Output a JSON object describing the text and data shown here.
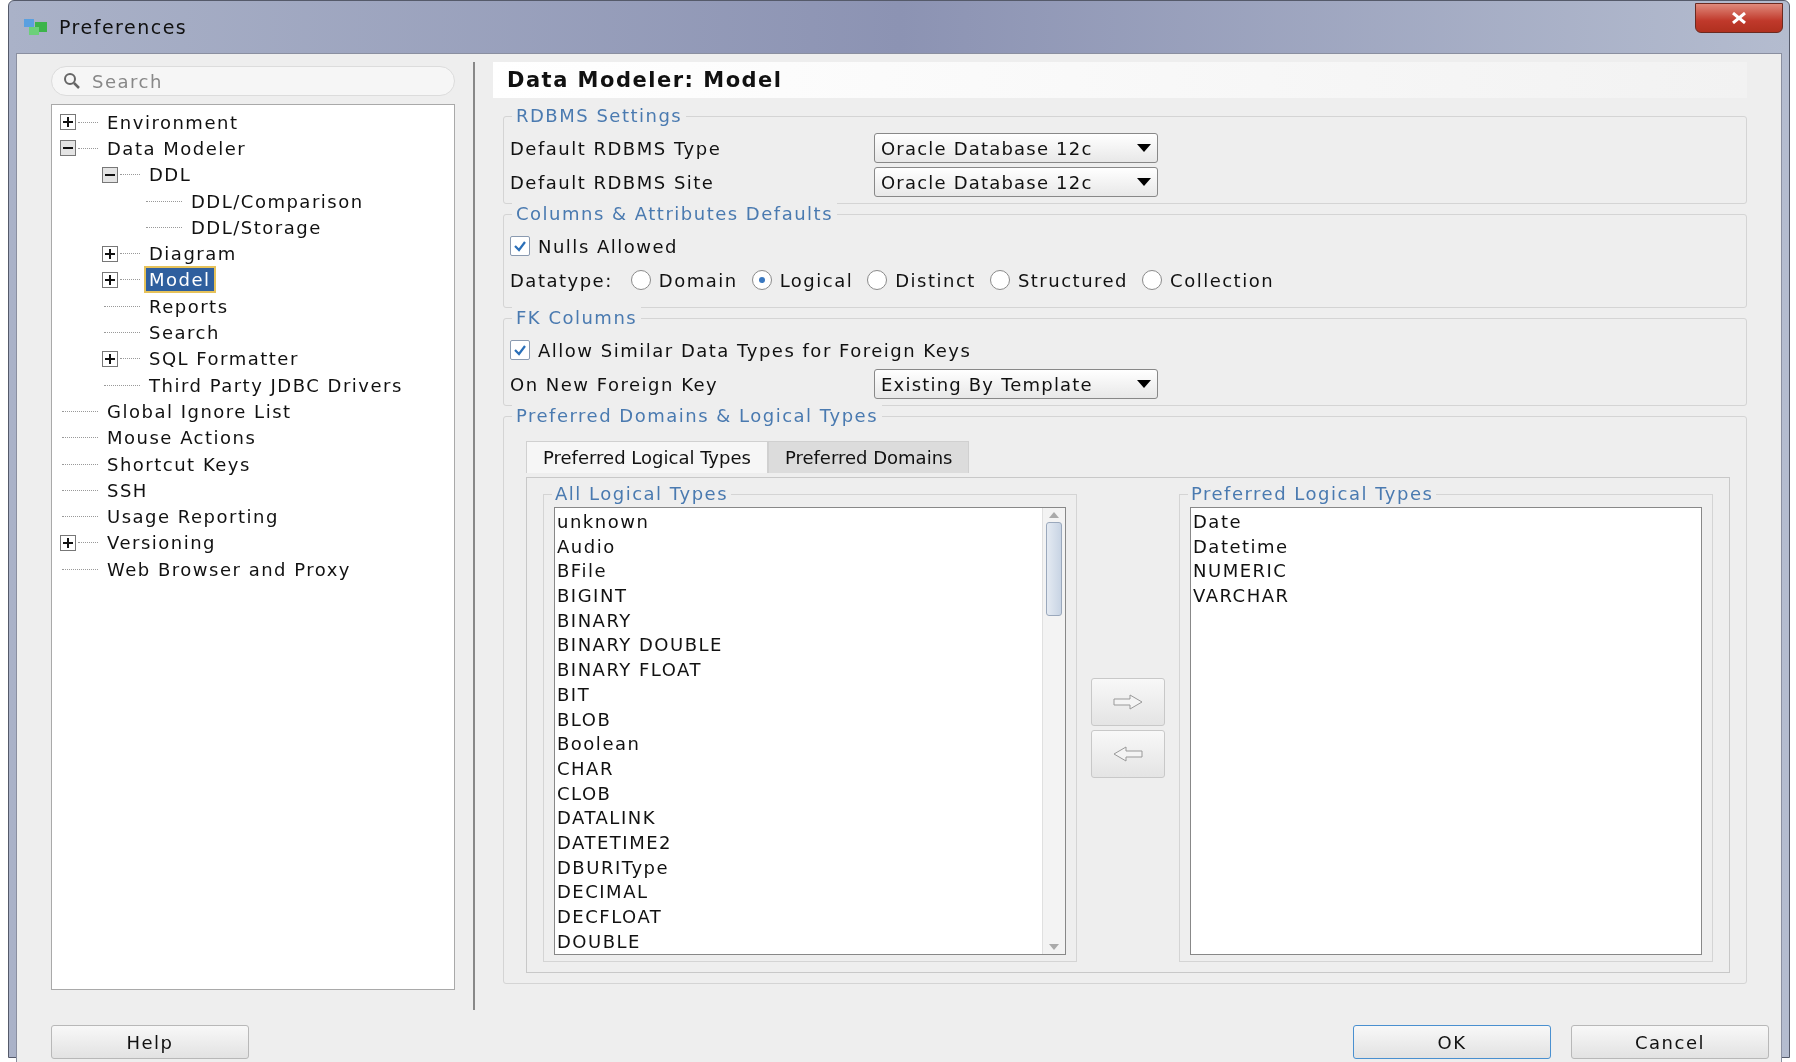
{
  "window": {
    "title": "Preferences"
  },
  "sidebar": {
    "search": {
      "placeholder": "Search"
    },
    "tree": [
      {
        "label": "Environment",
        "expanded": false,
        "selected": false
      },
      {
        "label": "Data Modeler",
        "expanded": true,
        "selected": false,
        "children": [
          {
            "label": "DDL",
            "expanded": true,
            "selected": false,
            "children": [
              {
                "label": "DDL/Comparison",
                "selected": false
              },
              {
                "label": "DDL/Storage",
                "selected": false
              }
            ]
          },
          {
            "label": "Diagram",
            "expanded": false,
            "selected": false
          },
          {
            "label": "Model",
            "expanded": false,
            "selected": true
          },
          {
            "label": "Reports",
            "selected": false
          },
          {
            "label": "Search",
            "selected": false
          },
          {
            "label": "SQL Formatter",
            "expanded": false,
            "selected": false
          },
          {
            "label": "Third Party JDBC Drivers",
            "selected": false
          }
        ]
      },
      {
        "label": "Global Ignore List",
        "selected": false
      },
      {
        "label": "Mouse Actions",
        "selected": false
      },
      {
        "label": "Shortcut Keys",
        "selected": false
      },
      {
        "label": "SSH",
        "selected": false
      },
      {
        "label": "Usage Reporting",
        "selected": false
      },
      {
        "label": "Versioning",
        "expanded": false,
        "selected": false
      },
      {
        "label": "Web Browser and Proxy",
        "selected": false
      }
    ]
  },
  "page": {
    "title": "Data Modeler: Model",
    "sections": [
      {
        "title": "RDBMS Settings",
        "rows": [
          {
            "kind": "dropdown",
            "label": "Default RDBMS Type",
            "value": "Oracle Database 12c"
          },
          {
            "kind": "dropdown",
            "label": "Default RDBMS Site",
            "value": "Oracle Database 12c"
          }
        ]
      },
      {
        "title": "Columns & Attributes Defaults",
        "rows": [
          {
            "kind": "checkbox",
            "label": "Nulls Allowed",
            "checked": true
          },
          {
            "kind": "radio_group",
            "label": "Datatype:",
            "options": [
              {
                "label": "Domain",
                "selected": false
              },
              {
                "label": "Logical",
                "selected": true
              },
              {
                "label": "Distinct",
                "selected": false
              },
              {
                "label": "Structured",
                "selected": false
              },
              {
                "label": "Collection",
                "selected": false
              }
            ]
          }
        ]
      },
      {
        "title": "FK Columns",
        "rows": [
          {
            "kind": "checkbox",
            "label": "Allow Similar Data Types for Foreign Keys",
            "checked": true
          },
          {
            "kind": "dropdown",
            "label": "On New Foreign Key",
            "value": "Existing By Template"
          }
        ]
      },
      {
        "title": "Preferred Domains & Logical Types",
        "rows": [
          {
            "kind": "tabbed_lists",
            "tabs": [
              {
                "label": "Preferred Logical Types",
                "selected": true
              },
              {
                "label": "Preferred Domains",
                "selected": false
              }
            ],
            "available": {
              "title": "All Logical Types",
              "items": [
                "unknown",
                "Audio",
                "BFile",
                "BIGINT",
                "BINARY",
                "BINARY DOUBLE",
                "BINARY FLOAT",
                "BIT",
                "BLOB",
                "Boolean",
                "CHAR",
                "CLOB",
                "DATALINK",
                "DATETIME2",
                "DBURIType",
                "DECIMAL",
                "DECFLOAT",
                "DOUBLE"
              ]
            },
            "preferred": {
              "title": "Preferred Logical Types",
              "items": [
                "Date",
                "Datetime",
                "NUMERIC",
                "VARCHAR"
              ]
            }
          }
        ]
      }
    ]
  },
  "buttons": [
    {
      "label": "Help",
      "default": false
    },
    {
      "label": "OK",
      "default": true
    },
    {
      "label": "Cancel",
      "default": false
    }
  ]
}
